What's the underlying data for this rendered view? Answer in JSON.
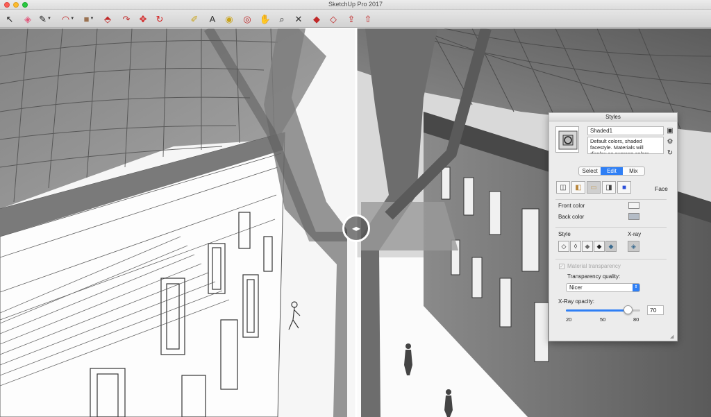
{
  "window": {
    "title": "SketchUp Pro 2017"
  },
  "toolbar": {
    "tools": [
      {
        "name": "select-tool-button",
        "icon": "arrow-icon",
        "glyph": "↖",
        "color": "#222222"
      },
      {
        "name": "eraser-tool-button",
        "icon": "eraser-icon",
        "glyph": "◈",
        "color": "#e0567a"
      },
      {
        "name": "line-tool-button",
        "icon": "pencil-icon",
        "glyph": "✎",
        "color": "#222222",
        "dropdown": true
      },
      {
        "name": "arc-tool-button",
        "icon": "arc-icon",
        "glyph": "◠",
        "color": "#c02828",
        "dropdown": true
      },
      {
        "name": "shape-tool-button",
        "icon": "rectangle-icon",
        "glyph": "■",
        "color": "#9a7150",
        "dropdown": true
      },
      {
        "name": "push-pull-tool-button",
        "icon": "push-pull-icon",
        "glyph": "⬘",
        "color": "#c02828"
      },
      {
        "name": "offset-tool-button",
        "icon": "offset-icon",
        "glyph": "↷",
        "color": "#c02828"
      },
      {
        "name": "move-tool-button",
        "icon": "move-icon",
        "glyph": "✥",
        "color": "#d32020"
      },
      {
        "name": "rotate-tool-button",
        "icon": "rotate-icon",
        "glyph": "↻",
        "color": "#d32020"
      },
      {
        "name": "tape-measure-tool-button",
        "icon": "tape-measure-icon",
        "glyph": "✐",
        "color": "#c9a41c"
      },
      {
        "name": "text-tool-button",
        "icon": "text-icon",
        "glyph": "A",
        "color": "#333333"
      },
      {
        "name": "paint-bucket-tool-button",
        "icon": "paint-bucket-icon",
        "glyph": "◉",
        "color": "#c9a41c"
      },
      {
        "name": "orbit-tool-button",
        "icon": "orbit-icon",
        "glyph": "◎",
        "color": "#c02828"
      },
      {
        "name": "pan-tool-button",
        "icon": "hand-icon",
        "glyph": "✋",
        "color": "#c9a41c"
      },
      {
        "name": "zoom-tool-button",
        "icon": "magnifier-icon",
        "glyph": "⌕",
        "color": "#333333"
      },
      {
        "name": "zoom-extents-tool-button",
        "icon": "zoom-extents-icon",
        "glyph": "✕",
        "color": "#333333"
      },
      {
        "name": "warehouse-button",
        "icon": "warehouse-icon",
        "glyph": "◆",
        "color": "#c02828"
      },
      {
        "name": "extension-warehouse-button",
        "icon": "extension-icon",
        "glyph": "◇",
        "color": "#c02828"
      },
      {
        "name": "share-model-button",
        "icon": "share-model-icon",
        "glyph": "⇪",
        "color": "#c02828"
      },
      {
        "name": "share-component-button",
        "icon": "share-component-icon",
        "glyph": "⇧",
        "color": "#c02828"
      }
    ]
  },
  "styles_panel": {
    "title": "Styles",
    "style_name": "Shaded1",
    "description": "Default colors, shaded facestyle.  Materials will display as average colors.",
    "tabs": [
      {
        "label": "Select",
        "active": false
      },
      {
        "label": "Edit",
        "active": true
      },
      {
        "label": "Mix",
        "active": false
      }
    ],
    "section_label": "Face",
    "front_color_label": "Front color",
    "front_color": "#f4f4f4",
    "back_color_label": "Back color",
    "back_color": "#b4bcc6",
    "style_label": "Style",
    "xray_label": "X-ray",
    "material_transparency_label": "Material transparency",
    "transparency_quality_label": "Transparency quality:",
    "transparency_quality_value": "Nicer",
    "xray_opacity_label": "X-Ray opacity:",
    "xray_opacity_value": "70",
    "slider_min_label": "20",
    "slider_mid_label": "50",
    "slider_max_label": "80",
    "slider_fraction": 0.83
  },
  "accent_color": "#2f7ff5"
}
